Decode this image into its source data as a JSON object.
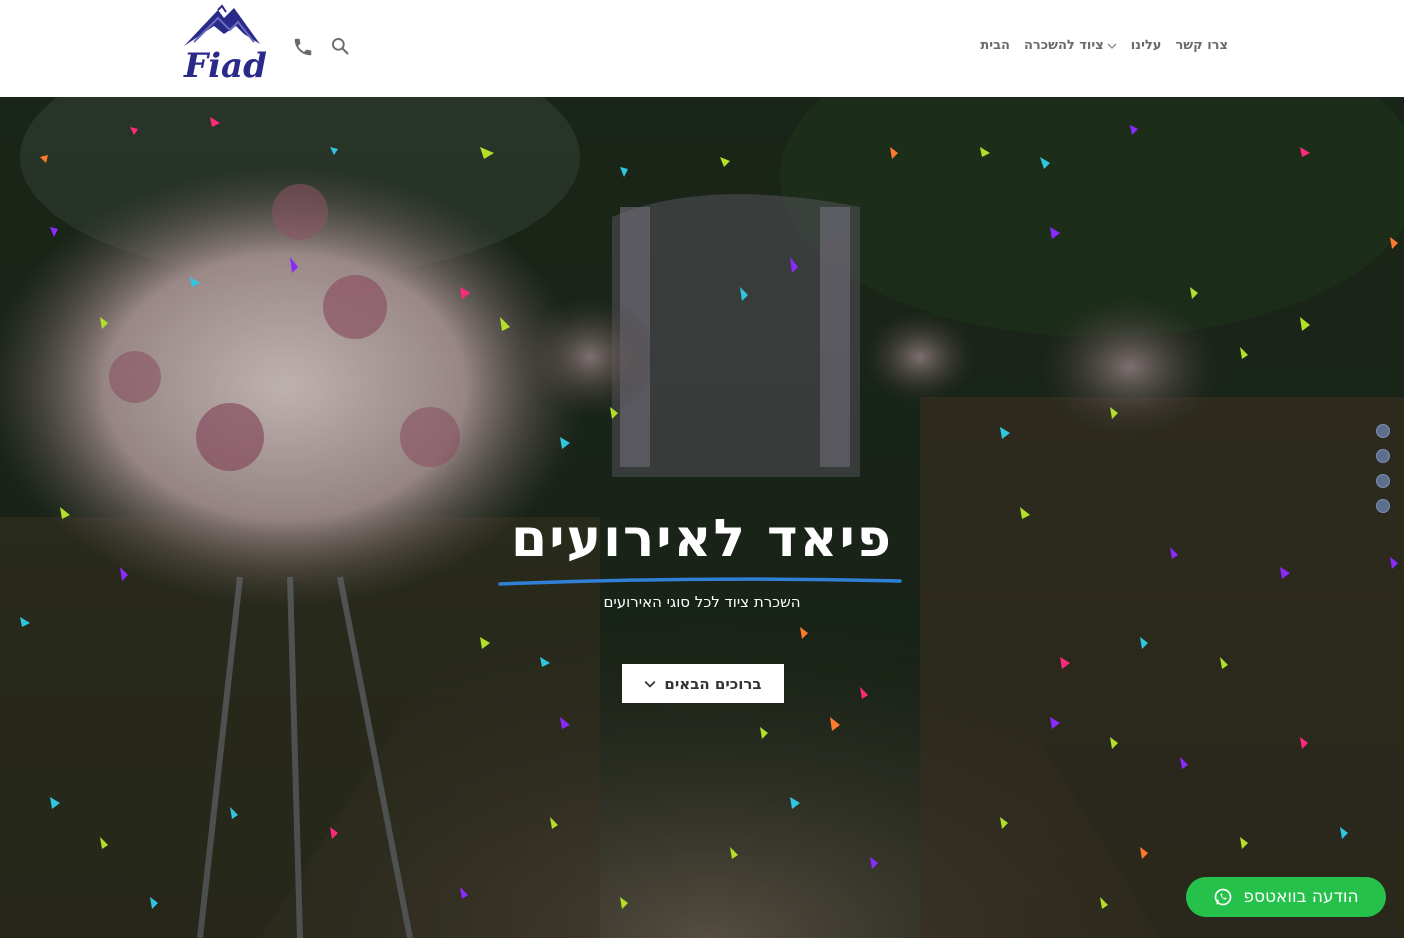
{
  "header": {
    "logo_text": "Fiad",
    "logo_icon": "tent-roof-icon",
    "nav": {
      "home": "הבית",
      "rental": "ציוד להשכרה",
      "about": "עלינו",
      "contact": "צרו קשר"
    },
    "icons": [
      "search-icon",
      "phone-icon"
    ]
  },
  "hero": {
    "title": "פיאד לאירועים",
    "subtitle": "השכרת ציוד לכל סוגי האירועים",
    "button_label": "ברוכים הבאים",
    "slide_count": 4,
    "active_slide": 1
  },
  "whatsapp": {
    "label": "הודעה בוואטספ"
  },
  "colors": {
    "underline": "#2f80d6",
    "whatsapp": "#25c14b",
    "logo": "#2a2a8a",
    "nav_text": "#6a6a6a"
  }
}
